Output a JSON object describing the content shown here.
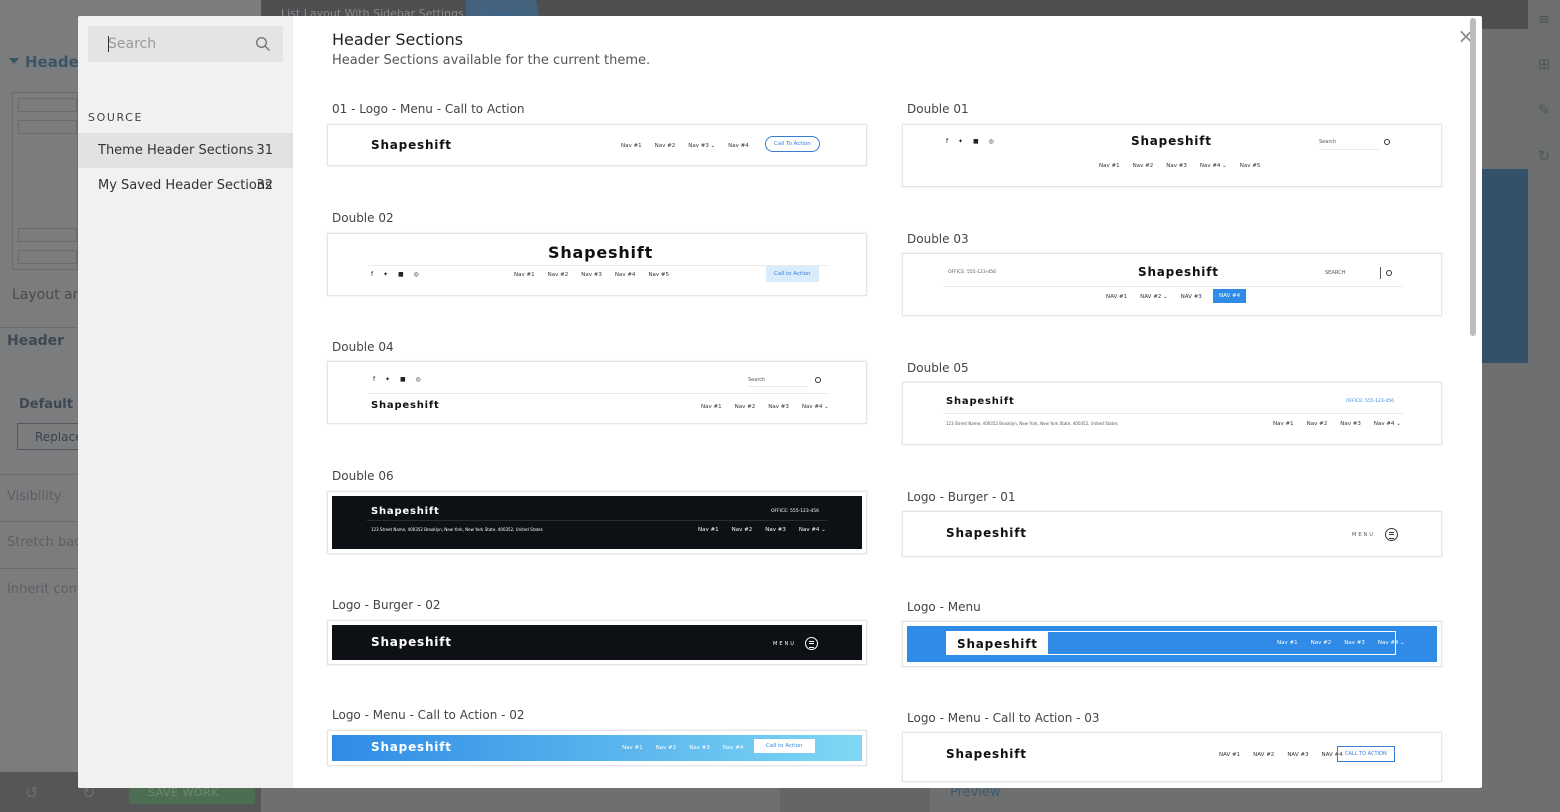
{
  "background": {
    "breadcrumb": "List Layout With Sidebar Settings",
    "breadcrumb_active": "Header",
    "panel_title": "Header C",
    "layout_label": "Layout and",
    "header_label": "Header",
    "default_label": "Default He",
    "replace_label": "Replace",
    "visibility_label": "Visibility",
    "stretch_label": "Stretch back",
    "inherit_label": "Inherit cont",
    "save_label": "SAVE WORK",
    "preview_label": "Preview"
  },
  "modal": {
    "search_placeholder": "Search",
    "source_label": "SOURCE",
    "sources": [
      {
        "label": "Theme Header Sections",
        "count": "31"
      },
      {
        "label": "My Saved Header Sections",
        "count": "32"
      }
    ],
    "title": "Header Sections",
    "subtitle": "Header Sections available for the current theme.",
    "close_glyph": "×",
    "logo_text": "Shapeshift",
    "cards": [
      {
        "label": "01 - Logo - Menu - Call to Action",
        "cta": "Call To Action",
        "nav": [
          "Nav #1",
          "Nav #2",
          "Nav #3 ⌄",
          "Nav #4"
        ]
      },
      {
        "label": "Double 01",
        "search": "Search",
        "nav": [
          "Nav #1",
          "Nav #2",
          "Nav #3",
          "Nav #4 ⌄",
          "Nav #5"
        ]
      },
      {
        "label": "Double 02",
        "cta": "Call to Action",
        "nav": [
          "Nav #1",
          "Nav #2",
          "Nav #3",
          "Nav #4",
          "Nav #5"
        ]
      },
      {
        "label": "Double 03",
        "office": "OFFICE: 555-123-456",
        "search": "SEARCH",
        "nav": [
          "NAV #1",
          "NAV #2 ⌄",
          "NAV #3"
        ],
        "nav_active": "NAV #4"
      },
      {
        "label": "Double 04",
        "search": "Search",
        "nav": [
          "Nav #1",
          "Nav #2",
          "Nav #3",
          "Nav #4 ⌄"
        ]
      },
      {
        "label": "Double 05",
        "office": "OFFICE: 555-123-456",
        "address": "123 Street Name, 400352 Brooklyn, New York, New York State, 400352, United States",
        "nav": [
          "Nav #1",
          "Nav #2",
          "Nav #3",
          "Nav #4 ⌄"
        ]
      },
      {
        "label": "Double 06",
        "office": "OFFICE: 555-123-456",
        "address": "123 Street Name, 400352 Brooklyn, New York, New York State, 400352, United States",
        "nav": [
          "Nav #1",
          "Nav #2",
          "Nav #3",
          "Nav #4 ⌄"
        ]
      },
      {
        "label": "Logo - Burger - 01",
        "menu": "MENU"
      },
      {
        "label": "Logo - Burger - 02",
        "menu": "MENU"
      },
      {
        "label": "Logo - Menu",
        "nav": [
          "Nav #1",
          "Nav #2",
          "Nav #3",
          "Nav #4 ⌄"
        ]
      },
      {
        "label": "Logo - Menu - Call to Action - 02",
        "cta": "Call to Action",
        "nav": [
          "Nav #1",
          "Nav #2",
          "Nav #3",
          "Nav #4"
        ]
      },
      {
        "label": "Logo - Menu - Call to Action - 03",
        "cta": "CALL TO ACTION",
        "nav": [
          "NAV #1",
          "NAV #2",
          "NAV #3",
          "NAV #4"
        ]
      }
    ]
  },
  "colors": {
    "accent": "#3a7bd5",
    "dark_header": "#0d1015",
    "blue_header": "#2f8be6",
    "gradient_from": "#2f8be6",
    "gradient_to": "#7fd8f3"
  }
}
